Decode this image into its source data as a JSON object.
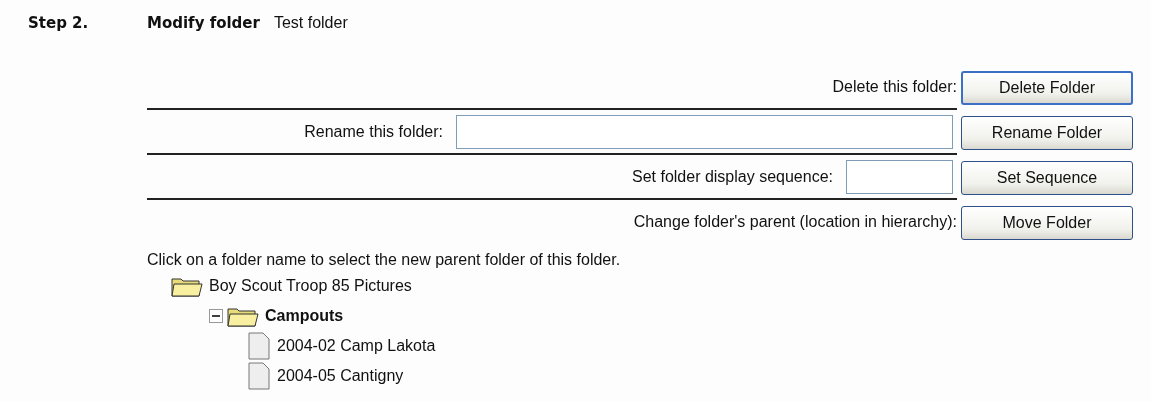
{
  "step": {
    "label": "Step 2.",
    "title": "Modify folder",
    "folder_name": "Test folder"
  },
  "actions": [
    {
      "label": "Delete this folder:",
      "button": "Delete Folder",
      "kind": "plain",
      "focused": true
    },
    {
      "label": "Rename this folder:",
      "button": "Rename Folder",
      "kind": "wide",
      "focused": false
    },
    {
      "label": "Set folder display sequence:",
      "button": "Set Sequence",
      "kind": "short",
      "focused": false
    },
    {
      "label": "Change folder's parent (location in hierarchy):",
      "button": "Move Folder",
      "kind": "plain",
      "focused": false
    }
  ],
  "instruction": "Click on a folder name to select the new parent folder of this folder.",
  "tree": [
    {
      "label": "Boy Scout Troop 85 Pictures",
      "kind": "folder",
      "selected": false,
      "children": [
        {
          "label": "Campouts",
          "kind": "folder",
          "selected": true,
          "expanded": true,
          "children": [
            {
              "label": "2004-02 Camp Lakota",
              "kind": "file",
              "selected": false
            },
            {
              "label": "2004-05 Cantigny",
              "kind": "file",
              "selected": false
            }
          ]
        }
      ]
    }
  ]
}
